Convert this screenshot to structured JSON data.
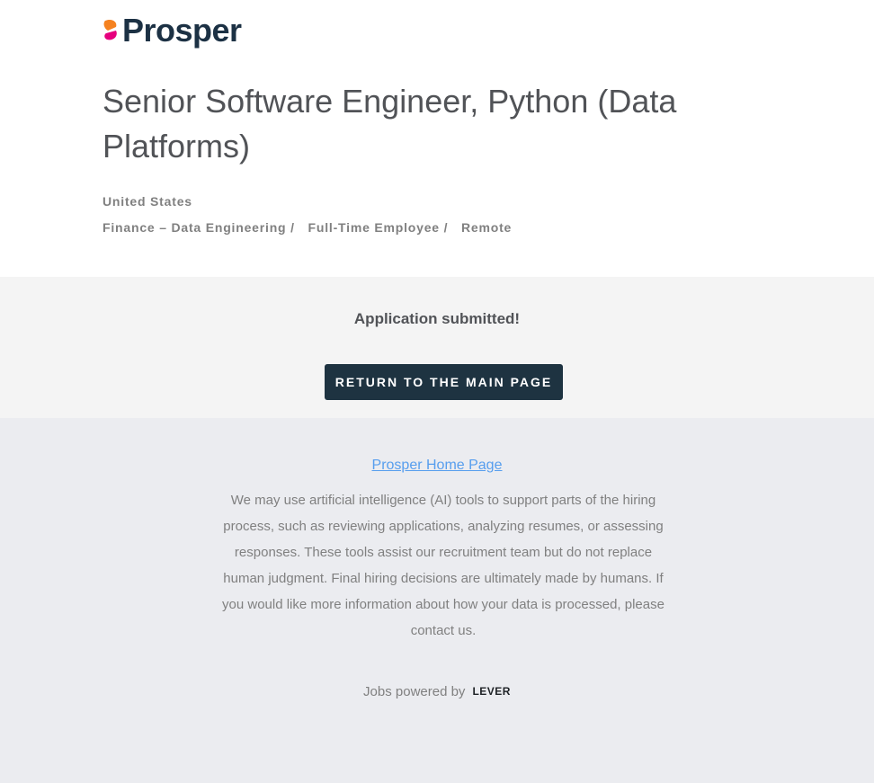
{
  "brand": {
    "name": "Prosper",
    "colors": {
      "mark_top": "#f58220",
      "mark_bottom": "#e6007e",
      "text": "#1c3144"
    }
  },
  "job": {
    "title": "Senior Software Engineer, Python (Data Platforms)",
    "location": "United States",
    "team": "Finance – Data Engineering /",
    "commitment": "Full-Time Employee /",
    "workplace": "Remote"
  },
  "confirmation": {
    "message": "Application submitted!",
    "button_label": "RETURN TO THE MAIN PAGE"
  },
  "footer": {
    "home_link": "Prosper Home Page",
    "disclaimer": "We may use artificial intelligence (AI) tools to support parts of the hiring process, such as reviewing applications, analyzing resumes, or assessing responses. These tools assist our recruitment team but do not replace human judgment. Final hiring decisions are ultimately made by humans. If you would like more information about how your data is processed, please contact us.",
    "powered_by": "Jobs powered by",
    "powered_brand": "LEVER"
  },
  "colors": {
    "button_bg": "#1e3341",
    "submitted_bg": "#f4f4f4",
    "footer_bg": "#ebecf0",
    "link": "#579eee"
  }
}
